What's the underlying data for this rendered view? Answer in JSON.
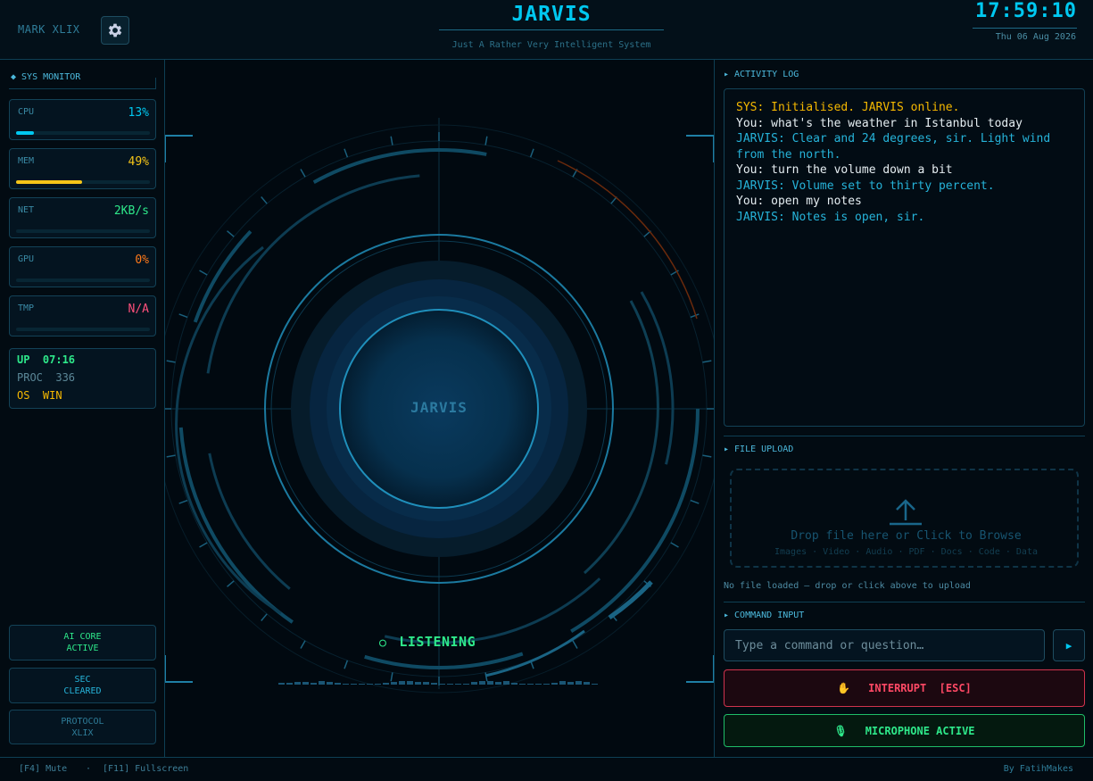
{
  "colors": {
    "accent": "#00c8f0",
    "yellow": "#f5c518",
    "green": "#2ee88a",
    "orange": "#ff7a1a",
    "pink": "#ff4f7b",
    "red": "#ff4965",
    "sys_log": "#f5b800",
    "user_log": "#e6eef2",
    "jarvis_log": "#26b3d9"
  },
  "header": {
    "brand": "MARK XLIX",
    "settings_icon": "gear-icon",
    "title": "JARVIS",
    "subtitle": "Just A Rather Very Intelligent System",
    "clock": "17:59:10",
    "date": "Thu 06 Aug 2026"
  },
  "sys_monitor": {
    "heading": "◆ SYS MONITOR",
    "metrics": [
      {
        "label": "CPU",
        "value": "13%",
        "fraction": 0.13,
        "color": "#00c8f0"
      },
      {
        "label": "MEM",
        "value": "49%",
        "fraction": 0.49,
        "color": "#f5c518"
      },
      {
        "label": "NET",
        "value": "2KB/s",
        "fraction": 0,
        "color": "#2ee88a"
      },
      {
        "label": "GPU",
        "value": "0%",
        "fraction": 0,
        "color": "#ff7a1a"
      },
      {
        "label": "TMP",
        "value": "N/A",
        "fraction": 0,
        "color": "#ff4f7b"
      }
    ],
    "uptime_label": "UP",
    "uptime_value": "07:16",
    "proc_label": "PROC",
    "proc_value": "336",
    "os_label": "OS",
    "os_value": "WIN"
  },
  "status_buttons": [
    {
      "line1": "AI CORE",
      "line2": "ACTIVE"
    },
    {
      "line1": "SEC",
      "line2": "CLEARED"
    },
    {
      "line1": "PROTOCOL",
      "line2": "XLIX"
    }
  ],
  "reactor": {
    "core_label": "JARVIS",
    "state_icon": "○",
    "state": "LISTENING"
  },
  "activity_log": {
    "heading": "▸ ACTIVITY LOG",
    "entries": [
      {
        "kind": "sys",
        "text": "SYS: Initialised. JARVIS online."
      },
      {
        "kind": "user",
        "text": "You: what's the weather in Istanbul today"
      },
      {
        "kind": "jarvis",
        "text": "JARVIS: Clear and 24 degrees, sir. Light wind from the north."
      },
      {
        "kind": "user",
        "text": "You: turn the volume down a bit"
      },
      {
        "kind": "jarvis",
        "text": "JARVIS: Volume set to thirty percent."
      },
      {
        "kind": "user",
        "text": "You: open my notes"
      },
      {
        "kind": "jarvis",
        "text": "JARVIS: Notes is open, sir."
      }
    ]
  },
  "file_upload": {
    "heading": "▸ FILE UPLOAD",
    "upload_icon": "upload-icon",
    "drop_text": "Drop file here  or  Click to Browse",
    "types": "Images · Video · Audio · PDF · Docs · Code · Data",
    "status": "No file loaded — drop or click above to upload"
  },
  "command": {
    "heading": "▸ COMMAND INPUT",
    "placeholder": "Type a command or question…",
    "value": "",
    "send_label": "▶",
    "interrupt_icon": "✋",
    "interrupt_label": "INTERRUPT  [ESC]",
    "mic_icon": "🎙",
    "mic_label": "MICROPHONE ACTIVE"
  },
  "footer": {
    "hint_mute": "[F4] Mute",
    "separator": "·",
    "hint_fullscreen": "[F11] Fullscreen",
    "credit": "By FatihMakes"
  }
}
